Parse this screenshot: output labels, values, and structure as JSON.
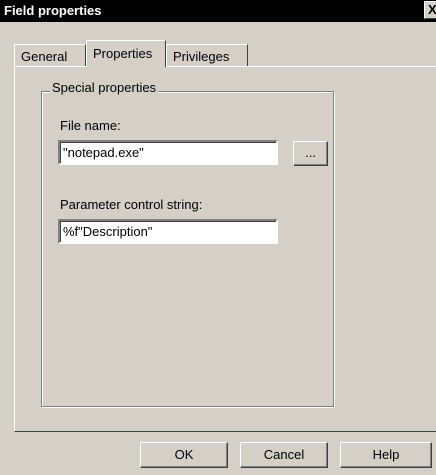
{
  "window": {
    "title": "Field properties",
    "close_glyph": "X"
  },
  "tabs": [
    {
      "label": "General",
      "active": false
    },
    {
      "label": "Properties",
      "active": true
    },
    {
      "label": "Privileges",
      "active": false
    }
  ],
  "special_properties": {
    "group_label": "Special properties",
    "file_name_label": "File name:",
    "file_name_value": "\"notepad.exe\"",
    "browse_label": "...",
    "param_label": "Parameter control string:",
    "param_value": "%f\"Description\""
  },
  "footer": {
    "ok_label": "OK",
    "cancel_label": "Cancel",
    "help_label": "Help"
  }
}
